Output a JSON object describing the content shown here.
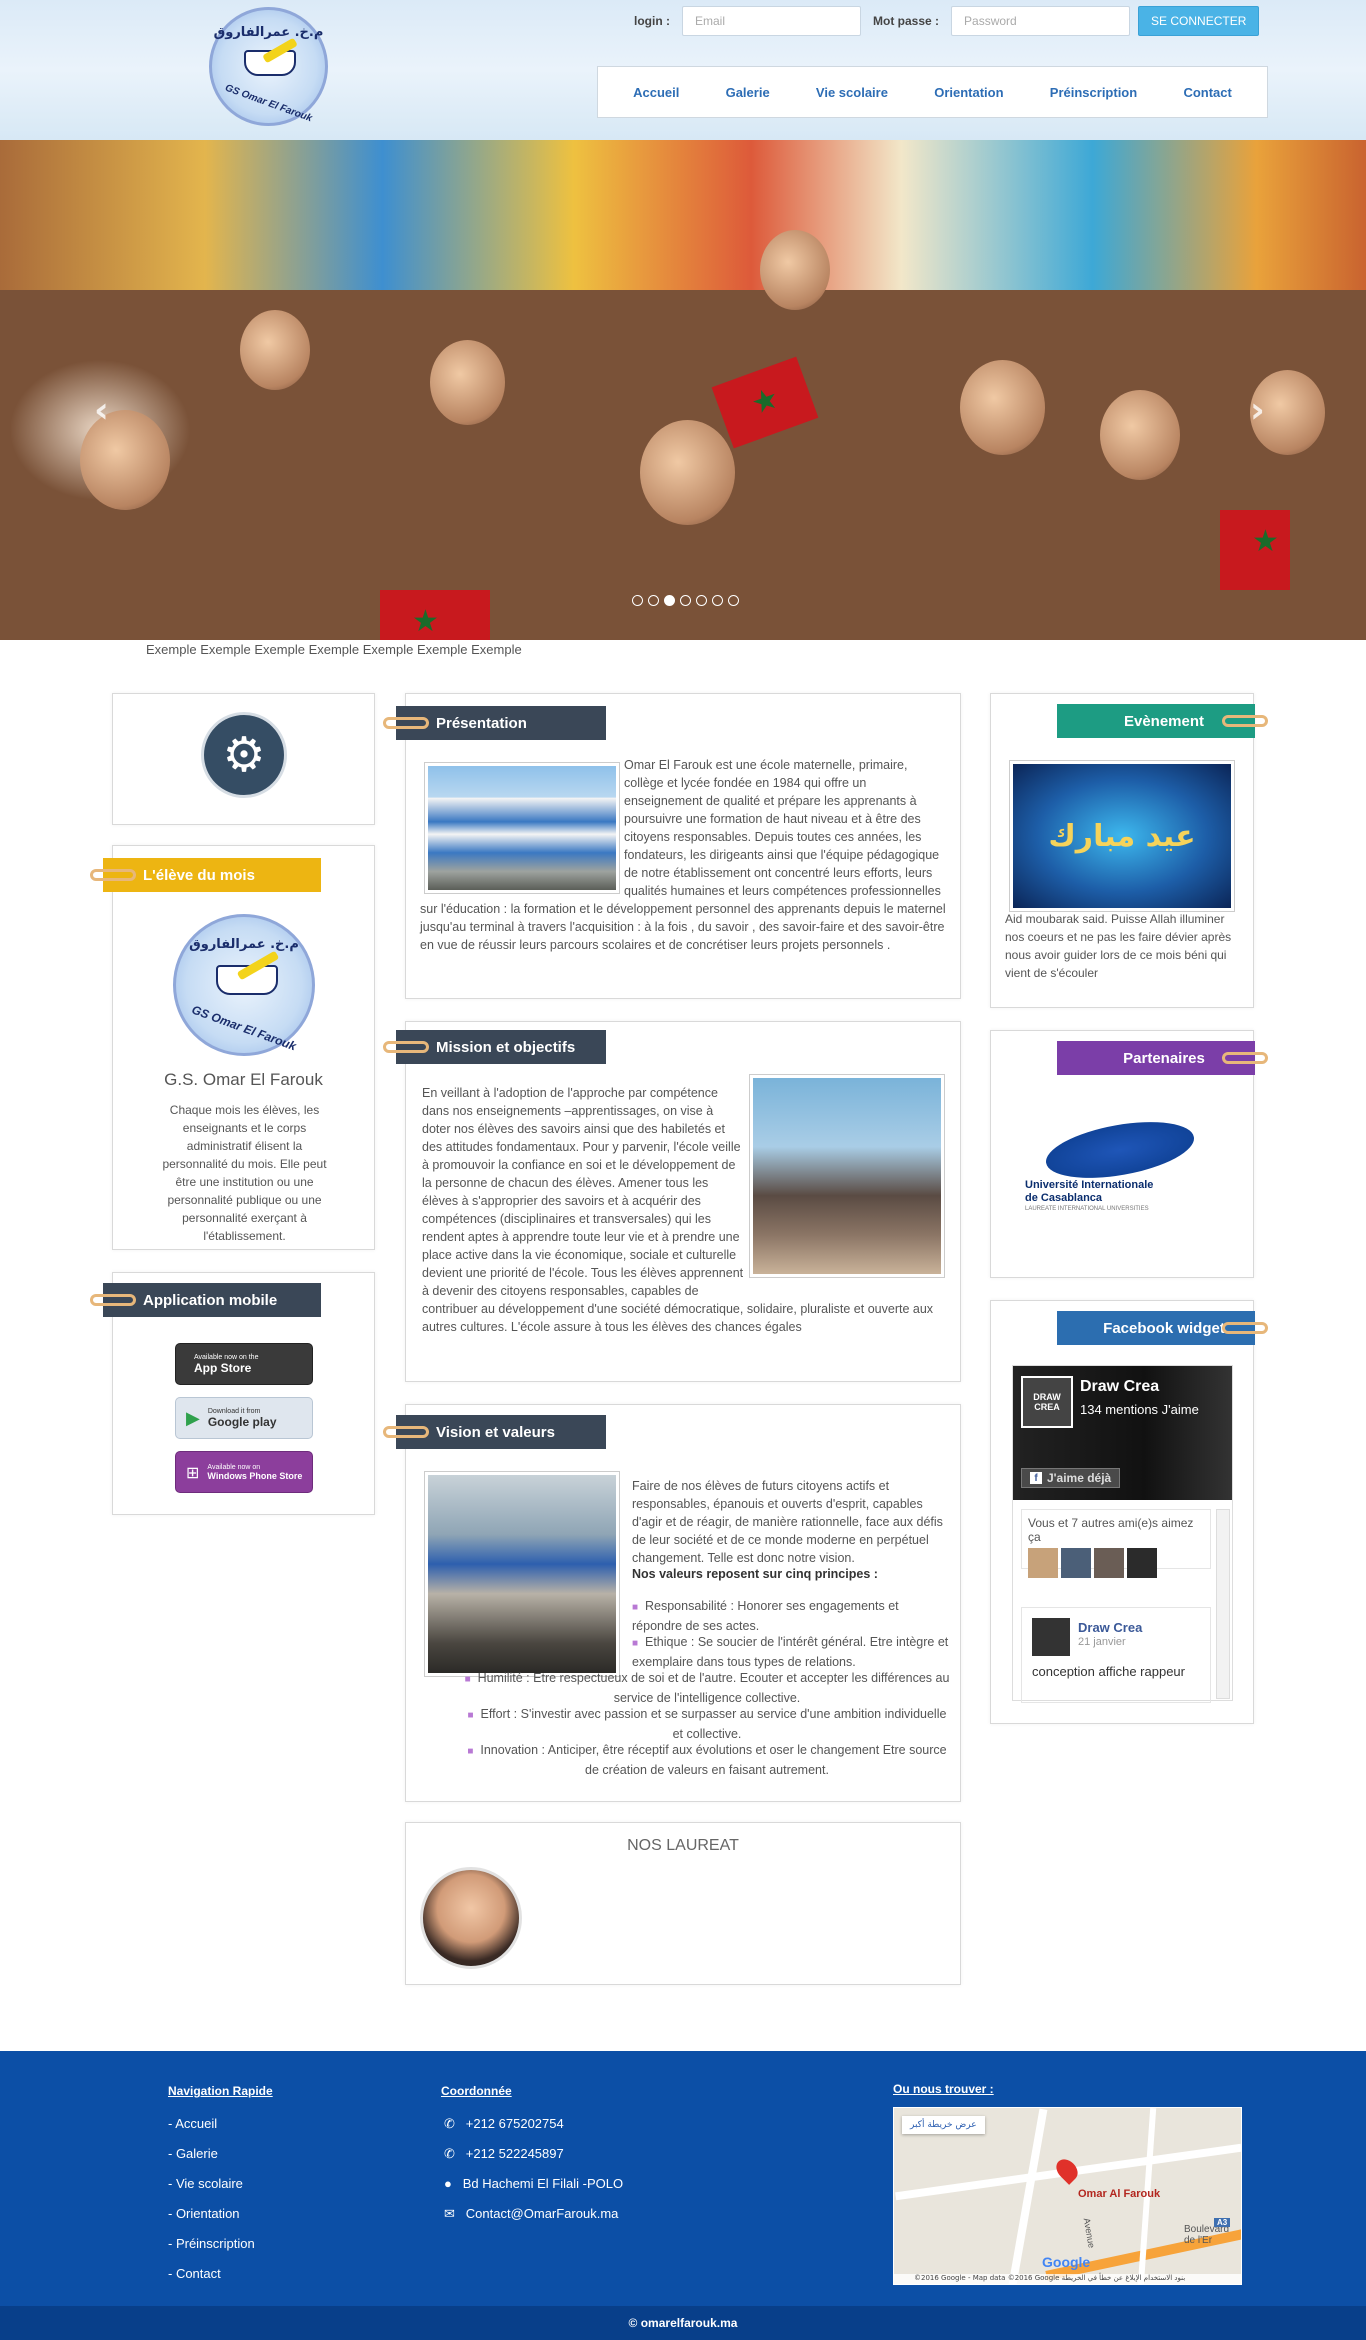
{
  "header": {
    "logo": {
      "arabic_text": "م.خ. عمرالفاروق",
      "ring_text": "GS Omar El Farouk"
    },
    "login_label": "login :",
    "email_placeholder": "Email",
    "password_label": "Mot passe :",
    "password_placeholder": "Password",
    "connect_button": "SE CONNECTER",
    "nav": [
      "Accueil",
      "Galerie",
      "Vie scolaire",
      "Orientation",
      "Préinscription",
      "Contact"
    ]
  },
  "slider": {
    "prev_icon": "chevron-left-icon",
    "next_icon": "chevron-right-icon",
    "prev_glyph": "‹",
    "next_glyph": "›",
    "dots_count": 7,
    "active_dot": 2,
    "caption": "Exemple Exemple Exemple Exemple Exemple Exemple Exemple"
  },
  "left_column": {
    "gear_icon": "gears-icon",
    "eleve": {
      "title": "L'élève du mois",
      "logo_arabic": "م.خ. عمرالفاروق",
      "logo_ring": "GS Omar El Farouk",
      "name": "G.S. Omar El Farouk",
      "text": "Chaque mois les élèves, les enseignants et le corps administratif élisent la personnalité du mois. Elle peut être une institution ou une personnalité publique ou une personnalité exerçant à l'établissement."
    },
    "app": {
      "title": "Application mobile",
      "stores": [
        {
          "small": "Available now on the",
          "big": "App Store",
          "icon": "apple-icon",
          "color": "#3a3a3a"
        },
        {
          "small": "Download it from",
          "big": "Google play",
          "icon": "google-play-icon",
          "color": "#dfe6ee"
        },
        {
          "small": "Available now on",
          "big": "Windows Phone Store",
          "icon": "windows-icon",
          "color": "#8c3e9c"
        }
      ]
    }
  },
  "center": {
    "presentation": {
      "title": "Présentation",
      "text": "Omar El Farouk est une école maternelle, primaire, collège et lycée fondée en 1984 qui offre un enseignement de qualité et prépare les apprenants à poursuivre une formation de haut niveau et à être des citoyens responsables. Depuis toutes ces années, les fondateurs, les dirigeants ainsi que l'équipe pédagogique de notre établissement ont concentré leurs efforts, leurs qualités humaines et leurs compétences professionnelles sur l'éducation : la formation et le développement personnel des apprenants depuis le maternel jusqu'au terminal à travers l'acquisition : à la fois , du savoir , des savoir-faire et des savoir-être en vue de réussir leurs parcours scolaires et de concrétiser leurs projets personnels ."
    },
    "mission": {
      "title": "Mission et objectifs",
      "text": "En veillant à l'adoption de l'approche par compétence dans nos enseignements –apprentissages, on vise à doter nos élèves des savoirs ainsi que des habiletés et des attitudes fondamentaux. Pour y parvenir, l'école veille à promouvoir la confiance en soi et le développement de la personne de chacun des élèves. Amener tous les élèves à s'approprier des savoirs et à acquérir des compétences (disciplinaires et transversales) qui les rendent aptes à apprendre toute leur vie et à prendre une place active dans la vie économique, sociale et culturelle devient une priorité de l'école. Tous les élèves apprennent à devenir des citoyens responsables, capables de contribuer au développement d'une société démocratique, solidaire, pluraliste et ouverte aux autres cultures. L'école assure à tous les élèves des chances égales"
    },
    "vision": {
      "title": "Vision et valeurs",
      "intro": "Faire de nos élèves de futurs citoyens actifs et responsables, épanouis et ouverts d'esprit, capables d'agir et de réagir, de manière rationnelle, face aux défis de leur société et de ce monde moderne en perpétuel changement. Telle est donc notre vision.",
      "values_title": "Nos valeurs reposent sur cinq principes :",
      "values": [
        "Responsabilité : Honorer ses engagements et répondre de ses actes.",
        "Ethique : Se soucier de l'intérêt général. Etre intègre et exemplaire dans tous types de relations.",
        "Humilité : Etre respectueux de soi et de l'autre. Ecouter et accepter les différences au service de l'intelligence collective.",
        "Effort : S'investir avec passion et se surpasser au service d'une ambition individuelle et collective.",
        "Innovation : Anticiper, être réceptif aux évolutions et oser le changement Etre source de création de valeurs en faisant autrement."
      ]
    },
    "laureat": {
      "title": "NOS LAUREAT"
    }
  },
  "right_column": {
    "evenement": {
      "title": "Evènement",
      "image_text": "عيد مبارك",
      "text": "Aid moubarak said. Puisse Allah illuminer nos coeurs et ne pas les faire dévier après nous avoir guider lors de ce mois béni qui vient de s'écouler"
    },
    "partenaires": {
      "title": "Partenaires",
      "partner_line1": "Université Internationale",
      "partner_line2": "de Casablanca",
      "partner_line3": "LAUREATE INTERNATIONAL UNIVERSITIES"
    },
    "facebook": {
      "title": "Facebook widget",
      "page_name": "Draw Crea",
      "likes": "134 mentions J'aime",
      "like_button": "J'aime déjà",
      "logo_text": "DRAW CREA",
      "friends_text": "Vous et 7 autres ami(e)s aimez ça",
      "post_author": "Draw Crea",
      "post_date": "21 janvier",
      "post_text": "conception affiche rappeur"
    }
  },
  "footer": {
    "nav_title": "Navigation Rapide",
    "nav_links": [
      "- Accueil",
      "- Galerie",
      "- Vie scolaire",
      "- Orientation",
      "- Préinscription",
      "- Contact"
    ],
    "coords_title": "Coordonnée",
    "coords": [
      {
        "icon": "phone-icon",
        "glyph": "✆",
        "text": "+212 675202754"
      },
      {
        "icon": "phone-icon",
        "glyph": "✆",
        "text": "+212 522245897"
      },
      {
        "icon": "map-marker-icon",
        "glyph": "●",
        "text": "Bd Hachemi El Filali -POLO"
      },
      {
        "icon": "envelope-icon",
        "glyph": "✉",
        "text": "Contact@OmarFarouk.ma"
      }
    ],
    "map_title": "Ou nous trouver :",
    "map": {
      "marker_label": "Omar Al Farouk",
      "larger_map": "عرض خريطة أكبر",
      "road_label": "Boulevard de l'Er",
      "avenue_label": "Avenue",
      "highway": "A3",
      "google": "Google",
      "attribution": "©2016 Google - Map data ©2016 Google   بنود الاستخدام   الإبلاغ عن خطأ في الخريطة"
    },
    "copyright": "© omarelfarouk.ma"
  }
}
